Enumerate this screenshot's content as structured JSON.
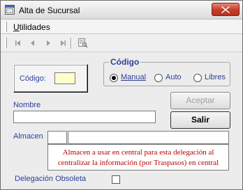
{
  "window": {
    "title": "Alta de Sucursal",
    "close_icon": "close-icon"
  },
  "menu": {
    "utilidades_first": "U",
    "utilidades_rest": "tilidades"
  },
  "toolbar": {
    "icons": [
      "first-record-icon",
      "previous-record-icon",
      "next-record-icon",
      "last-record-icon",
      "print-preview-icon"
    ]
  },
  "codigo_panel": {
    "label": "Código:",
    "value": ""
  },
  "codigo_mode": {
    "title": "Código",
    "options": [
      {
        "label": "Manual",
        "selected": true
      },
      {
        "label": "Auto",
        "selected": false
      },
      {
        "label": "Libres",
        "selected": false
      }
    ]
  },
  "buttons": {
    "aceptar": "Aceptar",
    "salir": "Salir"
  },
  "nombre": {
    "label": "Nombre",
    "value": ""
  },
  "almacen": {
    "label": "Almacen",
    "code": "",
    "name": "",
    "hint_line1": "Almacen a usar en central para esta delegación al",
    "hint_line2": "centralizar la información (por Traspasos) en central"
  },
  "obsoleta": {
    "label": "Delegación Obsoleta",
    "checked": false
  },
  "colors": {
    "label_blue": "#2c3e9b",
    "hint_red": "#b40000",
    "codigo_input_bg": "#ffffcc",
    "close_red": "#c23c28"
  }
}
